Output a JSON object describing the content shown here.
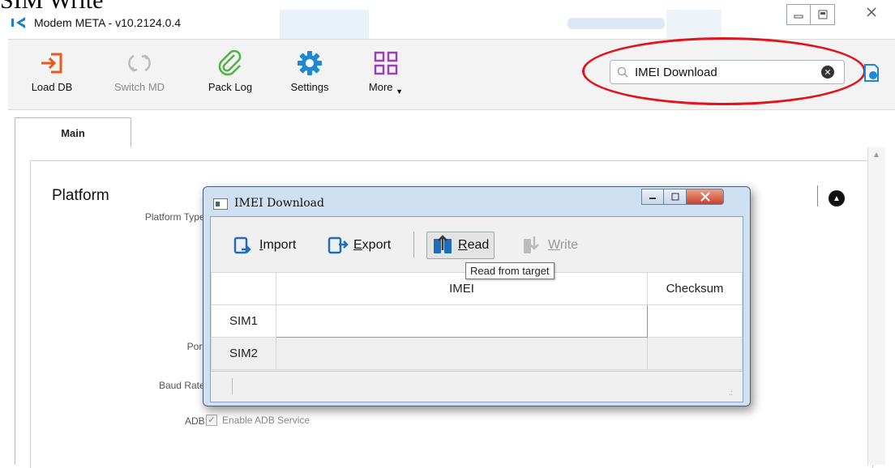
{
  "stray_text": "SIM Write",
  "window": {
    "title": "Modem META - v10.2124.0.4"
  },
  "toolbar": {
    "buttons": [
      {
        "label": "Load DB",
        "icon": "load-db-icon"
      },
      {
        "label": "Switch MD",
        "icon": "switch-md-icon"
      },
      {
        "label": "Pack Log",
        "icon": "paperclip-icon"
      },
      {
        "label": "Settings",
        "icon": "gear-icon"
      },
      {
        "label": "More",
        "icon": "grid-icon"
      }
    ]
  },
  "search": {
    "value": "IMEI Download"
  },
  "tabs": [
    {
      "label": "Main"
    }
  ],
  "platform": {
    "title": "Platform",
    "labels": {
      "platform_type": "Platform Type:",
      "port": "Port:",
      "baud_rate": "Baud Rate:",
      "adb": "ADB:"
    },
    "adb_option": "Enable ADB Service"
  },
  "dialog": {
    "title": "IMEI Download",
    "toolbar": {
      "import_rest": "mport",
      "import_key": "I",
      "export_rest": "xport",
      "export_key": "E",
      "read_rest": "ead",
      "read_key": "R",
      "write_rest": "rite",
      "write_key": "W"
    },
    "tooltip": "Read from target",
    "table": {
      "headers": [
        "",
        "IMEI",
        "Checksum"
      ],
      "rows": [
        {
          "label": "SIM1",
          "imei": "",
          "checksum": ""
        },
        {
          "label": "SIM2",
          "imei": "",
          "checksum": ""
        }
      ]
    }
  },
  "colors": {
    "annotation": "#e0141b",
    "accent": "#1e88d6",
    "dialog_frame": "#cfe0f2"
  }
}
